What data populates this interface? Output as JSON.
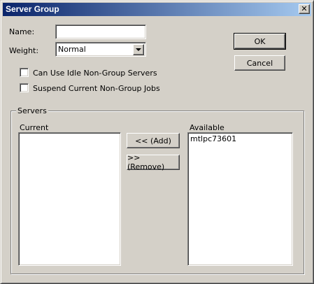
{
  "window": {
    "title": "Server Group",
    "close_glyph": "✕"
  },
  "form": {
    "name_label": "Name:",
    "name_value": "",
    "weight_label": "Weight:",
    "weight_value": "Normal",
    "idle_checkbox_label": "Can Use Idle Non-Group Servers",
    "idle_checked": false,
    "suspend_checkbox_label": "Suspend Current Non-Group Jobs",
    "suspend_checked": false
  },
  "buttons": {
    "ok": "OK",
    "cancel": "Cancel",
    "add": "<< (Add)",
    "remove": ">> (Remove)"
  },
  "servers": {
    "group_label": "Servers",
    "current_label": "Current",
    "current_items": [],
    "available_label": "Available",
    "available_items": [
      "mtlpc73601"
    ]
  },
  "colors": {
    "title_gradient_start": "#0a246a",
    "title_gradient_end": "#a6caf0",
    "face": "#d4d0c8"
  }
}
